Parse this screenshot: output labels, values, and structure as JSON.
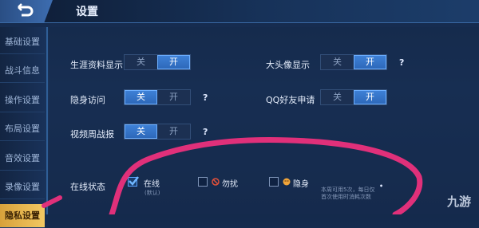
{
  "header": {
    "title": "设置"
  },
  "sidebar": {
    "items": [
      {
        "label": "基础设置"
      },
      {
        "label": "战斗信息"
      },
      {
        "label": "操作设置"
      },
      {
        "label": "布局设置"
      },
      {
        "label": "音效设置"
      },
      {
        "label": "录像设置"
      },
      {
        "label": "隐私设置"
      }
    ]
  },
  "settings": {
    "career_display": {
      "label": "生涯资料显示",
      "off": "关",
      "on": "开",
      "state": "on"
    },
    "avatar_display": {
      "label": "大头像显示",
      "off": "关",
      "on": "开",
      "state": "on",
      "help": "?"
    },
    "invisible_visit": {
      "label": "隐身访问",
      "off": "关",
      "on": "开",
      "state": "off",
      "help": "?"
    },
    "qq_friend_request": {
      "label": "QQ好友申请",
      "off": "关",
      "on": "开",
      "state": "on"
    },
    "video_weekly": {
      "label": "视频周战报",
      "off": "关",
      "on": "开",
      "state": "off",
      "help": "?"
    }
  },
  "online_status": {
    "label": "在线状态",
    "options": [
      {
        "label": "在线",
        "sub": "(默认)",
        "checked": true
      },
      {
        "label": "勿扰",
        "checked": false
      },
      {
        "label": "隐身",
        "sub": "本周可用5次，每日仅首次使用时消耗次数",
        "checked": false
      }
    ]
  },
  "watermark": "九游",
  "colors": {
    "accent_blue": "#3f82d8",
    "active_tab": "#f2c862",
    "annotation": "#e0307a"
  }
}
